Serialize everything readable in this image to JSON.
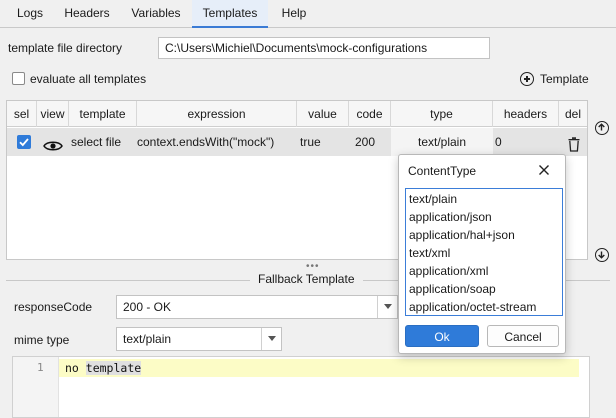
{
  "tabs": [
    {
      "label": "Logs",
      "active": false
    },
    {
      "label": "Headers",
      "active": false
    },
    {
      "label": "Variables",
      "active": false
    },
    {
      "label": "Templates",
      "active": true
    },
    {
      "label": "Help",
      "active": false
    }
  ],
  "template_dir": {
    "label": "template file directory",
    "value": "C:\\Users\\Michiel\\Documents\\mock-configurations"
  },
  "evaluate_all": {
    "label": "evaluate all templates",
    "checked": false
  },
  "add_template": {
    "label": "Template",
    "icon": "add-circle-icon"
  },
  "table": {
    "columns": [
      "sel",
      "view",
      "template",
      "expression",
      "value",
      "code",
      "type",
      "headers",
      "del"
    ],
    "rows": [
      {
        "sel": true,
        "view_icon": "eye-icon",
        "template": "select file",
        "expression": "context.endsWith(\"mock\")",
        "value": "true",
        "code": "200",
        "type": "text/plain",
        "headers": "0",
        "del_icon": "trash-icon"
      }
    ]
  },
  "side_buttons": {
    "up_icon": "arrow-up-circle-icon",
    "down_icon": "arrow-down-circle-icon"
  },
  "splitter": {
    "dots": "•••"
  },
  "fallback": {
    "title": "Fallback Template",
    "response_code_label": "responseCode",
    "response_code_value": "200 - OK",
    "mime_type_label": "mime type",
    "mime_type_value": "text/plain",
    "editor": {
      "line_number": "1",
      "code_prefix": "no ",
      "code_highlight": "template"
    }
  },
  "popup": {
    "title": "ContentType",
    "options": [
      "text/plain",
      "application/json",
      "application/hal+json",
      "text/xml",
      "application/xml",
      "application/soap",
      "application/octet-stream"
    ],
    "ok_label": "Ok",
    "cancel_label": "Cancel"
  },
  "colors": {
    "accent": "#2f7bd9",
    "selected_row": "#e4e4e4",
    "editor_line": "#fcfcc6"
  }
}
